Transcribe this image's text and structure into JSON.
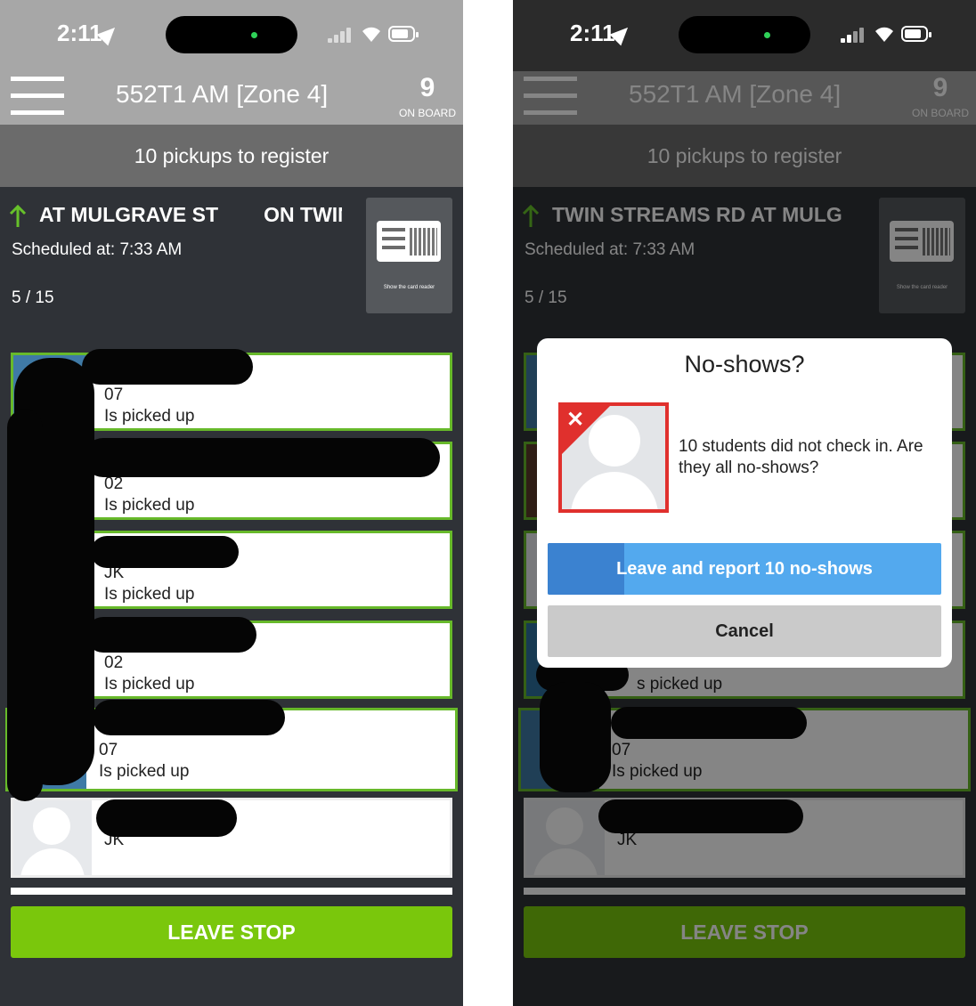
{
  "status_bar": {
    "time": "2:11"
  },
  "header": {
    "route_title": "552T1 AM [Zone 4]",
    "onboard_count": "9",
    "onboard_label": "ON BOARD"
  },
  "pickups_banner": "10 pickups to register",
  "stop": {
    "name_left": "AT MULGRAVE ST        ON TWIN",
    "name_right": "TWIN STREAMS RD AT MULG",
    "scheduled": "Scheduled at: 7:33 AM",
    "progress": "5 / 15"
  },
  "card_reader": {
    "caption": "Show the card reader"
  },
  "students": [
    {
      "grade": "07",
      "status": "Is picked up"
    },
    {
      "grade": "02",
      "status": "Is picked up"
    },
    {
      "grade": "JK",
      "status": "Is picked up"
    },
    {
      "grade": "02",
      "status": "Is picked up"
    },
    {
      "grade": "07",
      "status": "Is picked up"
    },
    {
      "grade": "JK",
      "status": ""
    }
  ],
  "leave_stop_label": "LEAVE STOP",
  "dialog": {
    "title": "No-shows?",
    "message": "10 students did not check in. Are they all no-shows?",
    "report_label": "Leave and report 10 no-shows",
    "cancel_label": "Cancel",
    "partial_status": "s picked up"
  },
  "colors": {
    "accent_green": "#7ac70c",
    "card_border": "#67b92a",
    "dialog_blue": "#53a9ee",
    "alert_red": "#e0302d"
  },
  "icons": [
    "location-arrow-icon",
    "signal-icon",
    "wifi-icon",
    "battery-icon",
    "hamburger-menu-icon",
    "up-arrow-icon",
    "card-reader-icon",
    "no-show-avatar-icon"
  ]
}
